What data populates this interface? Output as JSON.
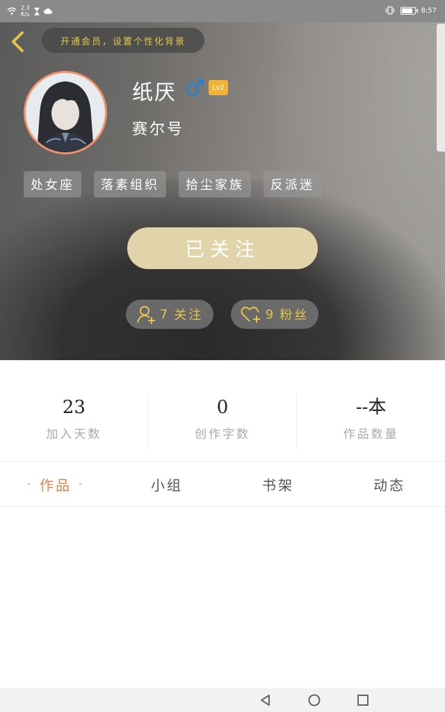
{
  "status_bar": {
    "speed_value": "2.3",
    "speed_unit": "K/s",
    "time": "8:57",
    "battery_percent": 80
  },
  "header": {
    "vip_banner": "开通会员，设置个性化背景",
    "username": "纸厌",
    "level": "Lv2",
    "seer_label": "赛尔号",
    "tags": [
      "处女座",
      "落素组织",
      "拾尘家族",
      "反派迷"
    ],
    "follow_button": "已关注",
    "following_count": "7",
    "following_label": "关注",
    "fans_count": "9",
    "fans_label": "粉丝"
  },
  "stats": [
    {
      "value": "23",
      "label": "加入天数"
    },
    {
      "value": "0",
      "label": "创作字数"
    },
    {
      "value": "--本",
      "label": "作品数量"
    }
  ],
  "tabs": [
    {
      "label": "作品",
      "active": true
    },
    {
      "label": "小组",
      "active": false
    },
    {
      "label": "书架",
      "active": false
    },
    {
      "label": "动态",
      "active": false
    }
  ],
  "colors": {
    "accent_gold": "#e6c34c",
    "follow_button": "#e2d4aa",
    "active_tab": "#e0834d",
    "gender_male": "#2f7fc9",
    "level_badge": "#f2b233",
    "avatar_border": "#f2926a"
  },
  "icons": {
    "back": "chevron-left-icon",
    "gender": "male-icon",
    "following": "add-user-icon",
    "fans": "add-heart-icon",
    "nav_back": "triangle-back-icon",
    "nav_home": "circle-home-icon",
    "nav_recent": "square-recent-icon"
  }
}
